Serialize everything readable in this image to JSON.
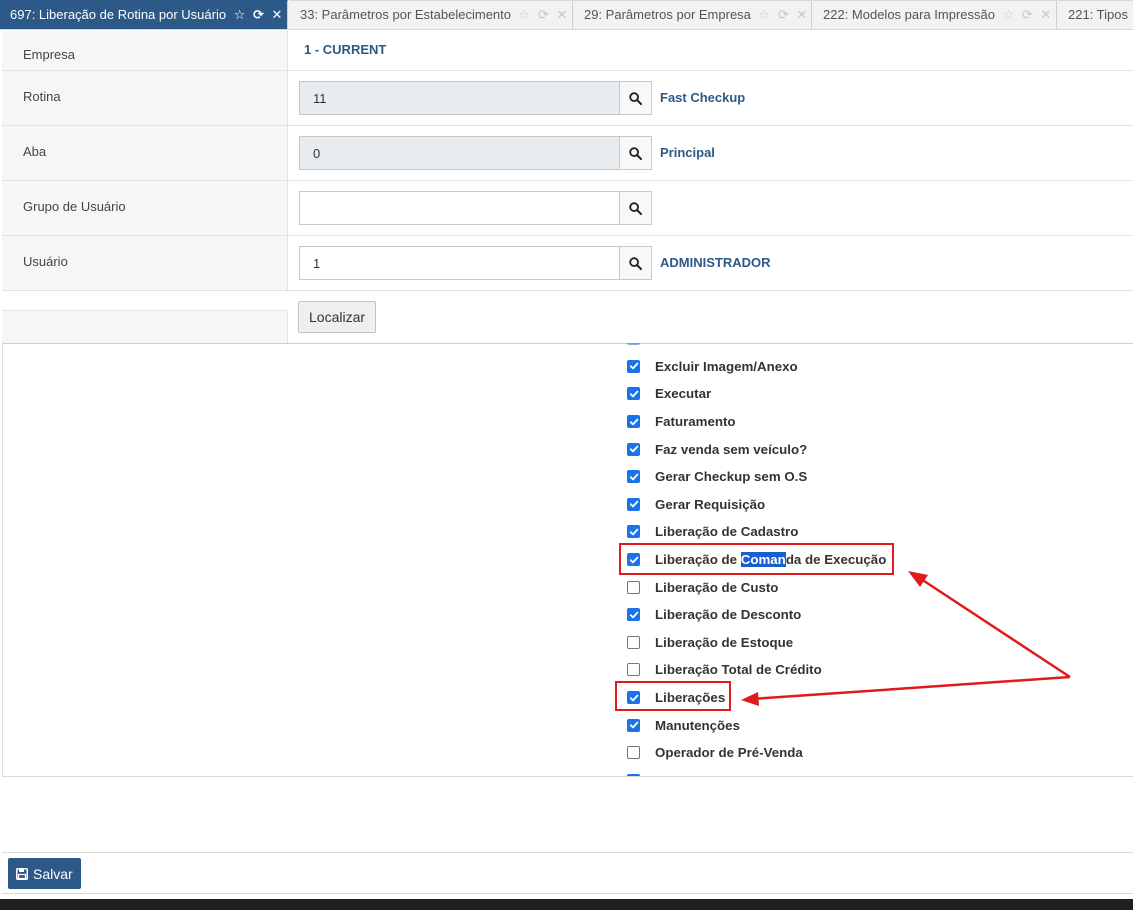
{
  "tabs": [
    {
      "label": "697: Liberação de Rotina por Usuário",
      "active": true
    },
    {
      "label": "33: Parâmetros por Estabelecimento",
      "active": false
    },
    {
      "label": "29: Parâmetros por Empresa",
      "active": false
    },
    {
      "label": "222: Modelos para Impressão",
      "active": false
    },
    {
      "label": "221: Tipos",
      "active": false
    }
  ],
  "form": {
    "empresa": {
      "label": "Empresa",
      "value": "1 - CURRENT"
    },
    "rotina": {
      "label": "Rotina",
      "value": "11",
      "description": "Fast Checkup"
    },
    "aba": {
      "label": "Aba",
      "value": "0",
      "description": "Principal"
    },
    "grupo": {
      "label": "Grupo de Usuário",
      "value": ""
    },
    "usuario": {
      "label": "Usuário",
      "value": "1",
      "description": "ADMINISTRADOR"
    },
    "localizar_label": "Localizar"
  },
  "permissions": [
    {
      "label": "Excluir Imagem/Anexo",
      "checked": true
    },
    {
      "label": "Executar",
      "checked": true
    },
    {
      "label": "Faturamento",
      "checked": true
    },
    {
      "label": "Faz venda sem veículo?",
      "checked": true
    },
    {
      "label": "Gerar Checkup sem O.S",
      "checked": true
    },
    {
      "label": "Gerar Requisição",
      "checked": true
    },
    {
      "label": "Liberação de Cadastro",
      "checked": true
    },
    {
      "label": "Liberação de Comanda de Execução",
      "checked": true,
      "highlight_parts": [
        "Liberação de ",
        "Coman",
        "da de Execução"
      ]
    },
    {
      "label": "Liberação de Custo",
      "checked": false
    },
    {
      "label": "Liberação de Desconto",
      "checked": true
    },
    {
      "label": "Liberação de Estoque",
      "checked": false
    },
    {
      "label": "Liberação Total de Crédito",
      "checked": false
    },
    {
      "label": "Liberações",
      "checked": true
    },
    {
      "label": "Manutenções",
      "checked": true
    },
    {
      "label": "Operador de Pré-Venda",
      "checked": false
    }
  ],
  "footer": {
    "save_label": "Salvar"
  },
  "icons": {
    "tab_actions": [
      "star-icon",
      "refresh-icon",
      "close-icon"
    ],
    "lookup": "search-icon",
    "save": "floppy-icon"
  },
  "colors": {
    "primary": "#2c5987",
    "annotation": "#e01b1b",
    "checkbox": "#1a73e8"
  }
}
